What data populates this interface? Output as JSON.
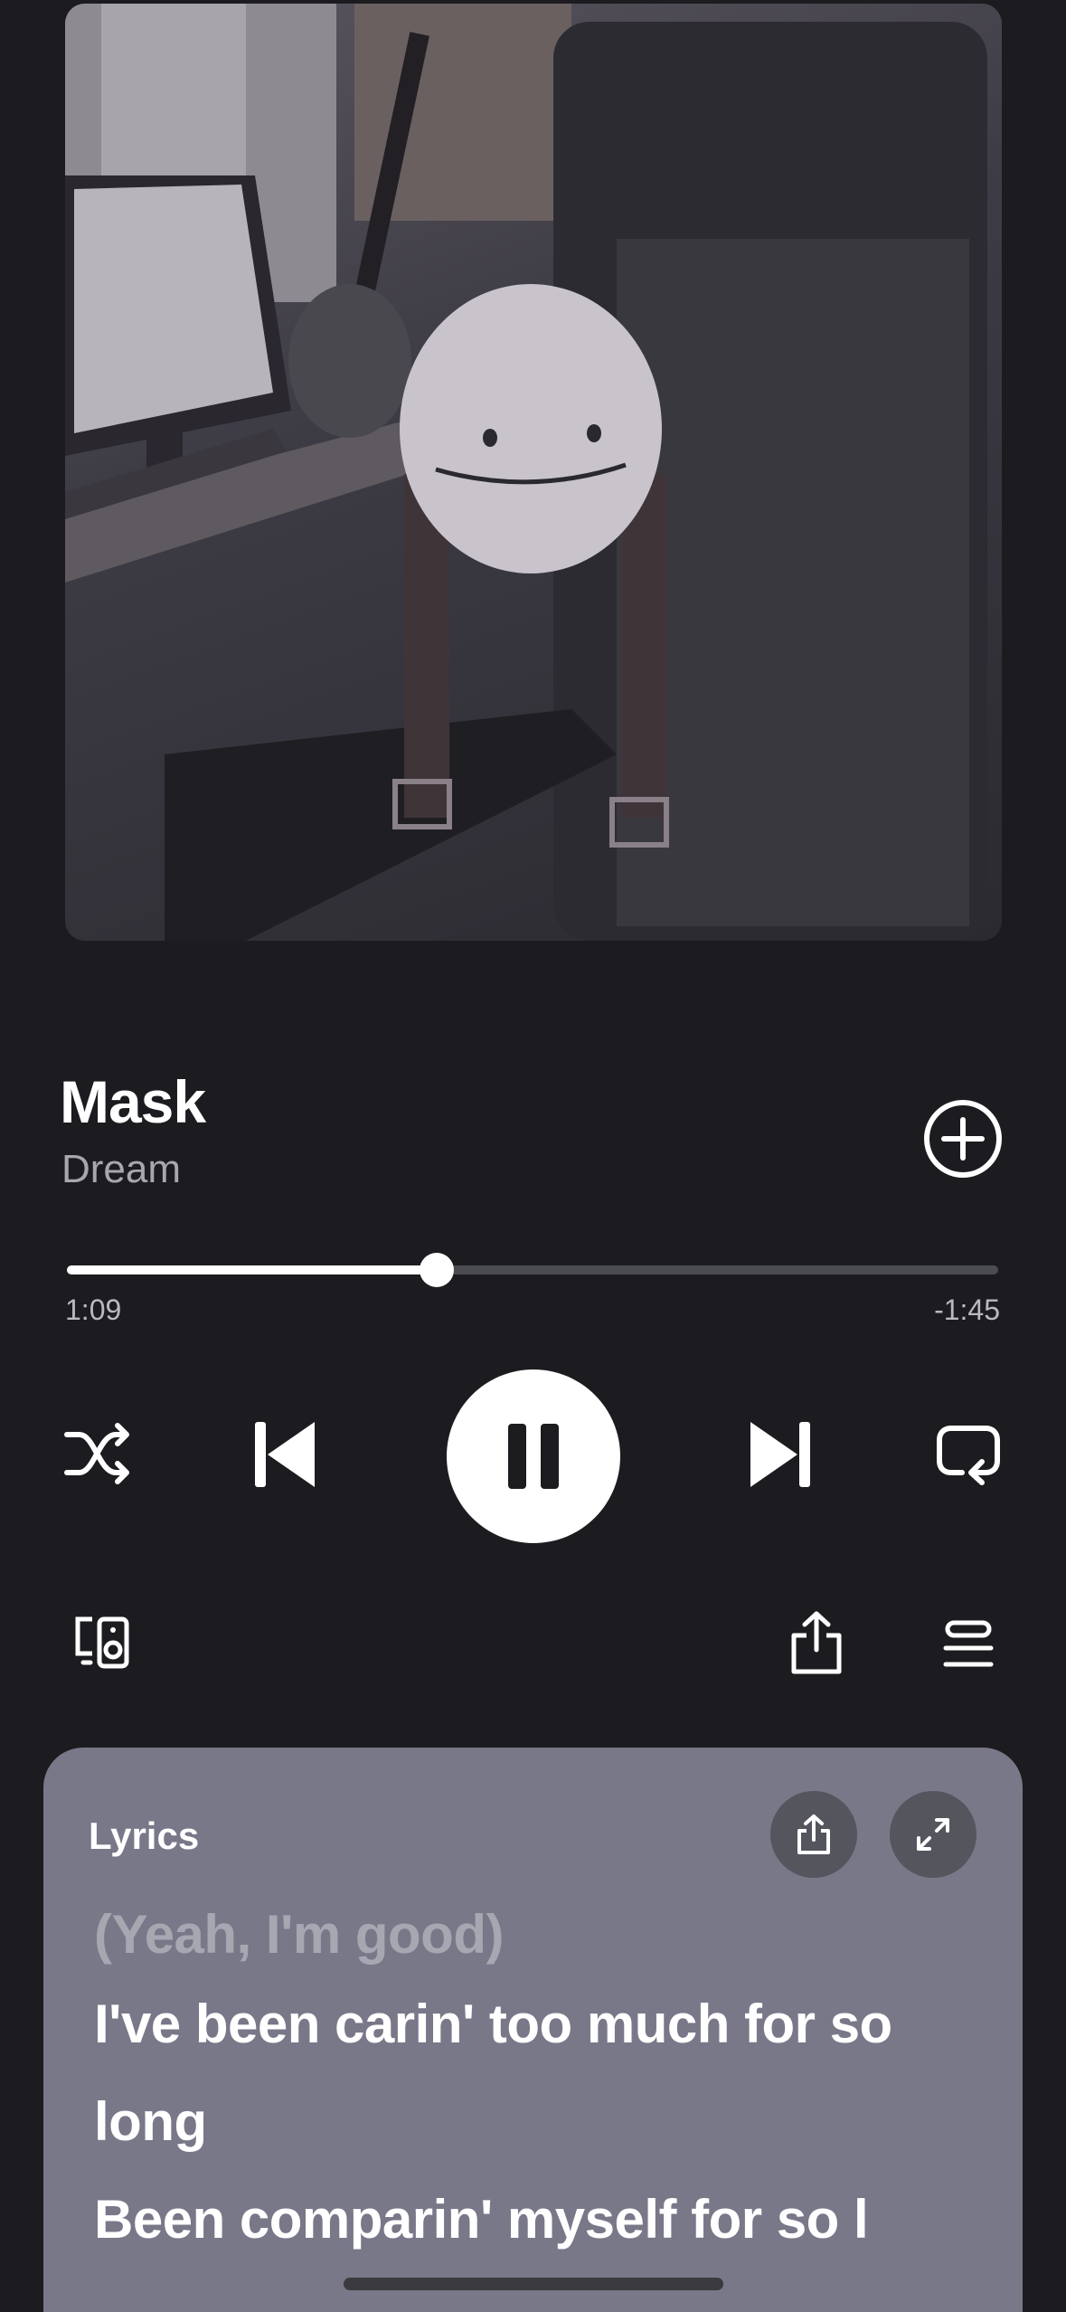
{
  "track": {
    "title": "Mask",
    "artist": "Dream"
  },
  "playback": {
    "elapsed": "1:09",
    "remaining": "-1:45",
    "progress_fraction": 0.397,
    "state": "playing"
  },
  "icons": {
    "add": "add-circle-icon",
    "shuffle": "shuffle-icon",
    "previous": "skip-previous-icon",
    "pause": "pause-icon",
    "next": "skip-next-icon",
    "repeat": "repeat-icon",
    "devices": "connect-device-icon",
    "share": "share-icon",
    "queue": "queue-icon",
    "expand": "expand-icon"
  },
  "lyrics": {
    "heading": "Lyrics",
    "lines": [
      "(Yeah, I'm good)",
      "I've been carin' too much for so long",
      "Been comparin' myself for so l"
    ]
  },
  "colors": {
    "background": "#1c1c20",
    "lyrics_card": "#787889",
    "accent": "#ffffff"
  }
}
